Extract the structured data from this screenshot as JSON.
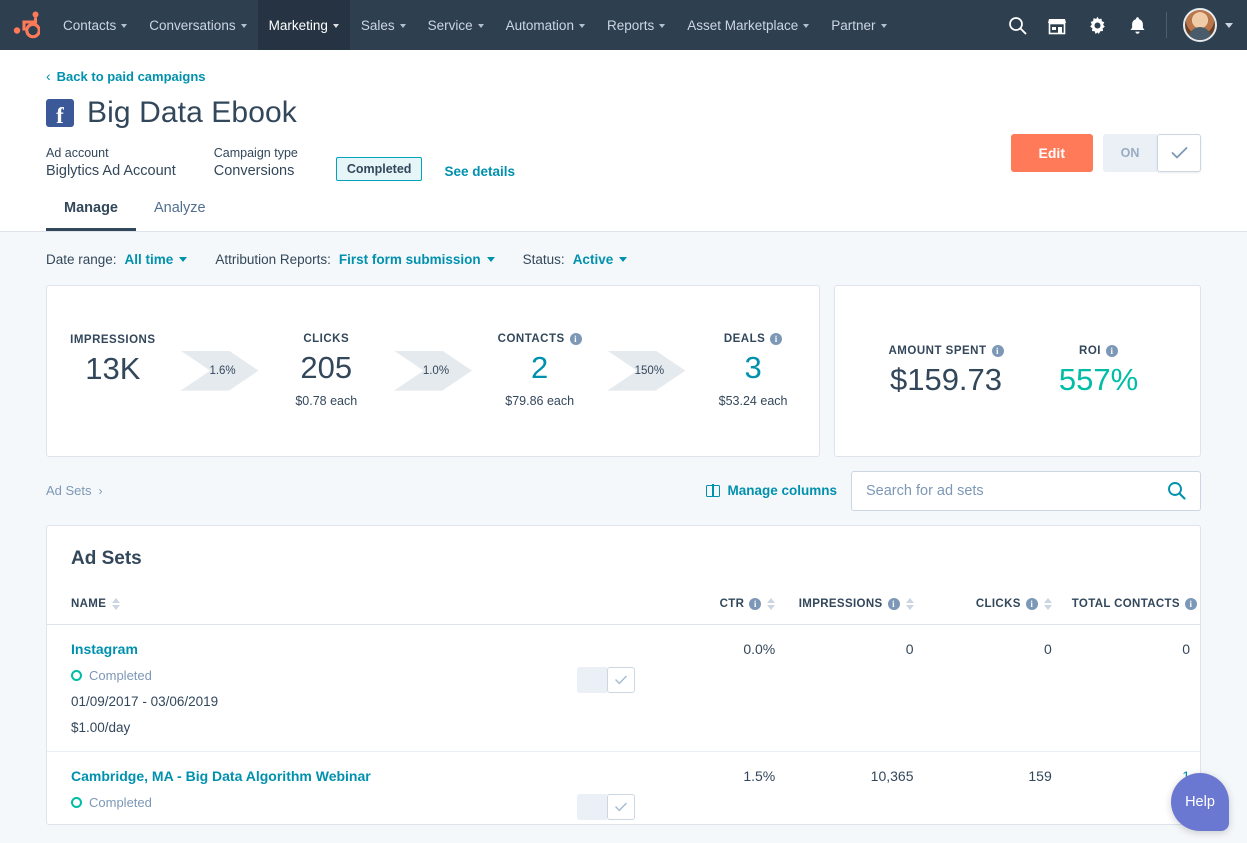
{
  "nav": {
    "logo_icon": "hubspot-sprocket-icon",
    "items": [
      {
        "label": "Contacts",
        "active": false
      },
      {
        "label": "Conversations",
        "active": false
      },
      {
        "label": "Marketing",
        "active": true
      },
      {
        "label": "Sales",
        "active": false
      },
      {
        "label": "Service",
        "active": false
      },
      {
        "label": "Automation",
        "active": false
      },
      {
        "label": "Reports",
        "active": false
      },
      {
        "label": "Asset Marketplace",
        "active": false
      },
      {
        "label": "Partner",
        "active": false
      }
    ],
    "icons": [
      "search-icon",
      "marketplace-icon",
      "gear-icon",
      "bell-icon"
    ]
  },
  "header": {
    "back_link": "Back to paid campaigns",
    "back_chevron": "‹",
    "channel_icon": "facebook-icon",
    "channel_letter": "f",
    "title": "Big Data Ebook",
    "ad_account_label": "Ad account",
    "ad_account_value": "Biglytics Ad Account",
    "campaign_type_label": "Campaign type",
    "campaign_type_value": "Conversions",
    "status_badge": "Completed",
    "see_details": "See details",
    "edit_button": "Edit",
    "toggle_off_label": "ON",
    "toggle_check": "✓"
  },
  "tabs": [
    {
      "label": "Manage",
      "active": true
    },
    {
      "label": "Analyze",
      "active": false
    }
  ],
  "filters": {
    "date_range_label": "Date range:",
    "date_range_value": "All time",
    "attribution_label": "Attribution Reports:",
    "attribution_value": "First form submission",
    "status_label": "Status:",
    "status_value": "Active"
  },
  "metrics": {
    "funnel": [
      {
        "label": "IMPRESSIONS",
        "value": "13K",
        "sub": "",
        "info": false,
        "color": "dark"
      },
      {
        "label": "CLICKS",
        "value": "205",
        "sub": "$0.78 each",
        "info": false,
        "color": "dark"
      },
      {
        "label": "CONTACTS",
        "value": "2",
        "sub": "$79.86 each",
        "info": true,
        "color": "teal"
      },
      {
        "label": "DEALS",
        "value": "3",
        "sub": "$53.24 each",
        "info": true,
        "color": "teal"
      }
    ],
    "conversions": [
      "1.6%",
      "1.0%",
      "150%"
    ],
    "spend": [
      {
        "label": "AMOUNT SPENT",
        "value": "$159.73",
        "info": true,
        "color": "dark"
      },
      {
        "label": "ROI",
        "value": "557%",
        "info": true,
        "color": "green"
      }
    ]
  },
  "toolbar": {
    "breadcrumb": "Ad Sets",
    "breadcrumb_arrow": "›",
    "manage_columns": "Manage columns",
    "search_placeholder": "Search for ad sets",
    "search_value": "",
    "search_icon": "search-icon"
  },
  "table": {
    "title": "Ad Sets",
    "columns": [
      {
        "label": "NAME",
        "info": false
      },
      {
        "label": "CTR",
        "info": true
      },
      {
        "label": "IMPRESSIONS",
        "info": true
      },
      {
        "label": "CLICKS",
        "info": true
      },
      {
        "label": "TOTAL CONTACTS",
        "info": true
      }
    ],
    "rows": [
      {
        "name": "Instagram",
        "status": "Completed",
        "dates": "01/09/2017 - 03/06/2019",
        "budget": "$1.00/day",
        "ctr": "0.0%",
        "impressions": "0",
        "clicks": "0",
        "total_contacts": "0",
        "contacts_teal": false,
        "has_toggle": true
      },
      {
        "name": "Cambridge, MA - Big Data Algorithm Webinar",
        "status": "Completed",
        "dates": "",
        "budget": "",
        "ctr": "1.5%",
        "impressions": "10,365",
        "clicks": "159",
        "total_contacts": "1",
        "contacts_teal": true,
        "has_toggle": true
      }
    ]
  },
  "help": {
    "label": "Help"
  },
  "colors": {
    "nav_bg": "#2e3f50",
    "accent_orange": "#ff7a59",
    "link_teal": "#0091ae",
    "green": "#00bda5",
    "help_purple": "#6a78d1",
    "page_bg": "#f5f8fa"
  }
}
